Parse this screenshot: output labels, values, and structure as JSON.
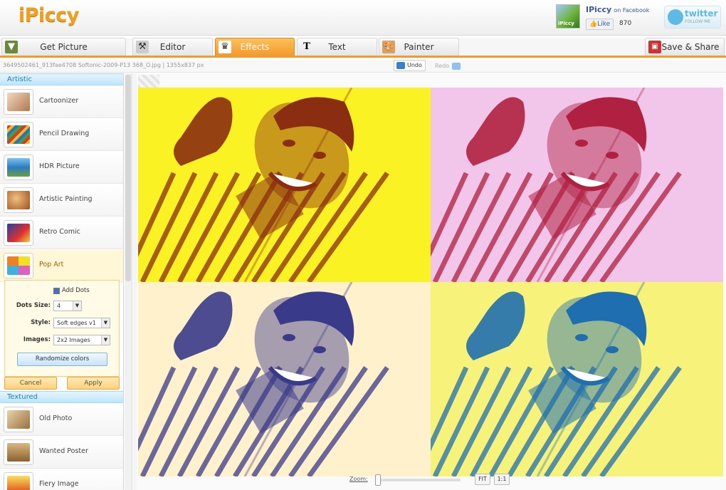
{
  "header": {
    "logo": "iPiccy",
    "facebook": {
      "thumb_label": "iPiccy",
      "name": "IPiccy",
      "suffix": "on Facebook",
      "like_label": "Like",
      "like_count": "870"
    },
    "twitter": {
      "title": "twitter",
      "subtitle": "FOLLOW ME"
    }
  },
  "tabs": [
    {
      "label": "Get Picture",
      "icon": "download-icon",
      "active": false
    },
    {
      "label": "Editor",
      "icon": "tools-icon",
      "active": false
    },
    {
      "label": "Effects",
      "icon": "magic-hat-icon",
      "active": true
    },
    {
      "label": "Text",
      "icon": "text-icon",
      "active": false
    },
    {
      "label": "Painter",
      "icon": "palette-icon",
      "active": false
    }
  ],
  "save_share_label": "Save & Share",
  "infobar": {
    "file": "3649502461_913fae4708 Softonic-2009-P13 368_O.jpg | 1355x837 px",
    "undo_label": "Undo",
    "redo_label": "Redo"
  },
  "panel": {
    "artistic_header": "Artistic",
    "artistic_items": [
      {
        "label": "Cartoonizer",
        "color": "#e0b890"
      },
      {
        "label": "Pencil Drawing",
        "color": "#c0a080"
      },
      {
        "label": "HDR Picture",
        "color": "#4a9ad0"
      },
      {
        "label": "Artistic Painting",
        "color": "#c88040"
      },
      {
        "label": "Retro Comic",
        "color": "#d04040"
      },
      {
        "label": "Pop Art",
        "color": "#e060a0"
      }
    ],
    "popart_options": {
      "add_dots_label": "Add Dots",
      "dots_size_label": "Dots Size:",
      "dots_size_value": "4",
      "style_label": "Style:",
      "style_value": "Soft edges v1",
      "images_label": "Images:",
      "images_value": "2x2 Images",
      "randomize_label": "Randomize colors"
    },
    "cancel_label": "Cancel",
    "apply_label": "Apply",
    "textured_header": "Textured",
    "textured_items": [
      {
        "label": "Old Photo",
        "color": "#b89060"
      },
      {
        "label": "Wanted Poster",
        "color": "#a07848"
      },
      {
        "label": "Fiery Image",
        "color": "#f0a020"
      }
    ]
  },
  "canvas": {
    "quad_colors": [
      "#fbf223",
      "#f2c6ea",
      "#fff1cc",
      "#f7f27a"
    ],
    "figure_colors": [
      "#8a2d10",
      "#b02040",
      "#3a3a8a",
      "#1f6fb0"
    ]
  },
  "zoom": {
    "label": "Zoom:",
    "fit_label": "FIT",
    "one_label": "1:1"
  }
}
